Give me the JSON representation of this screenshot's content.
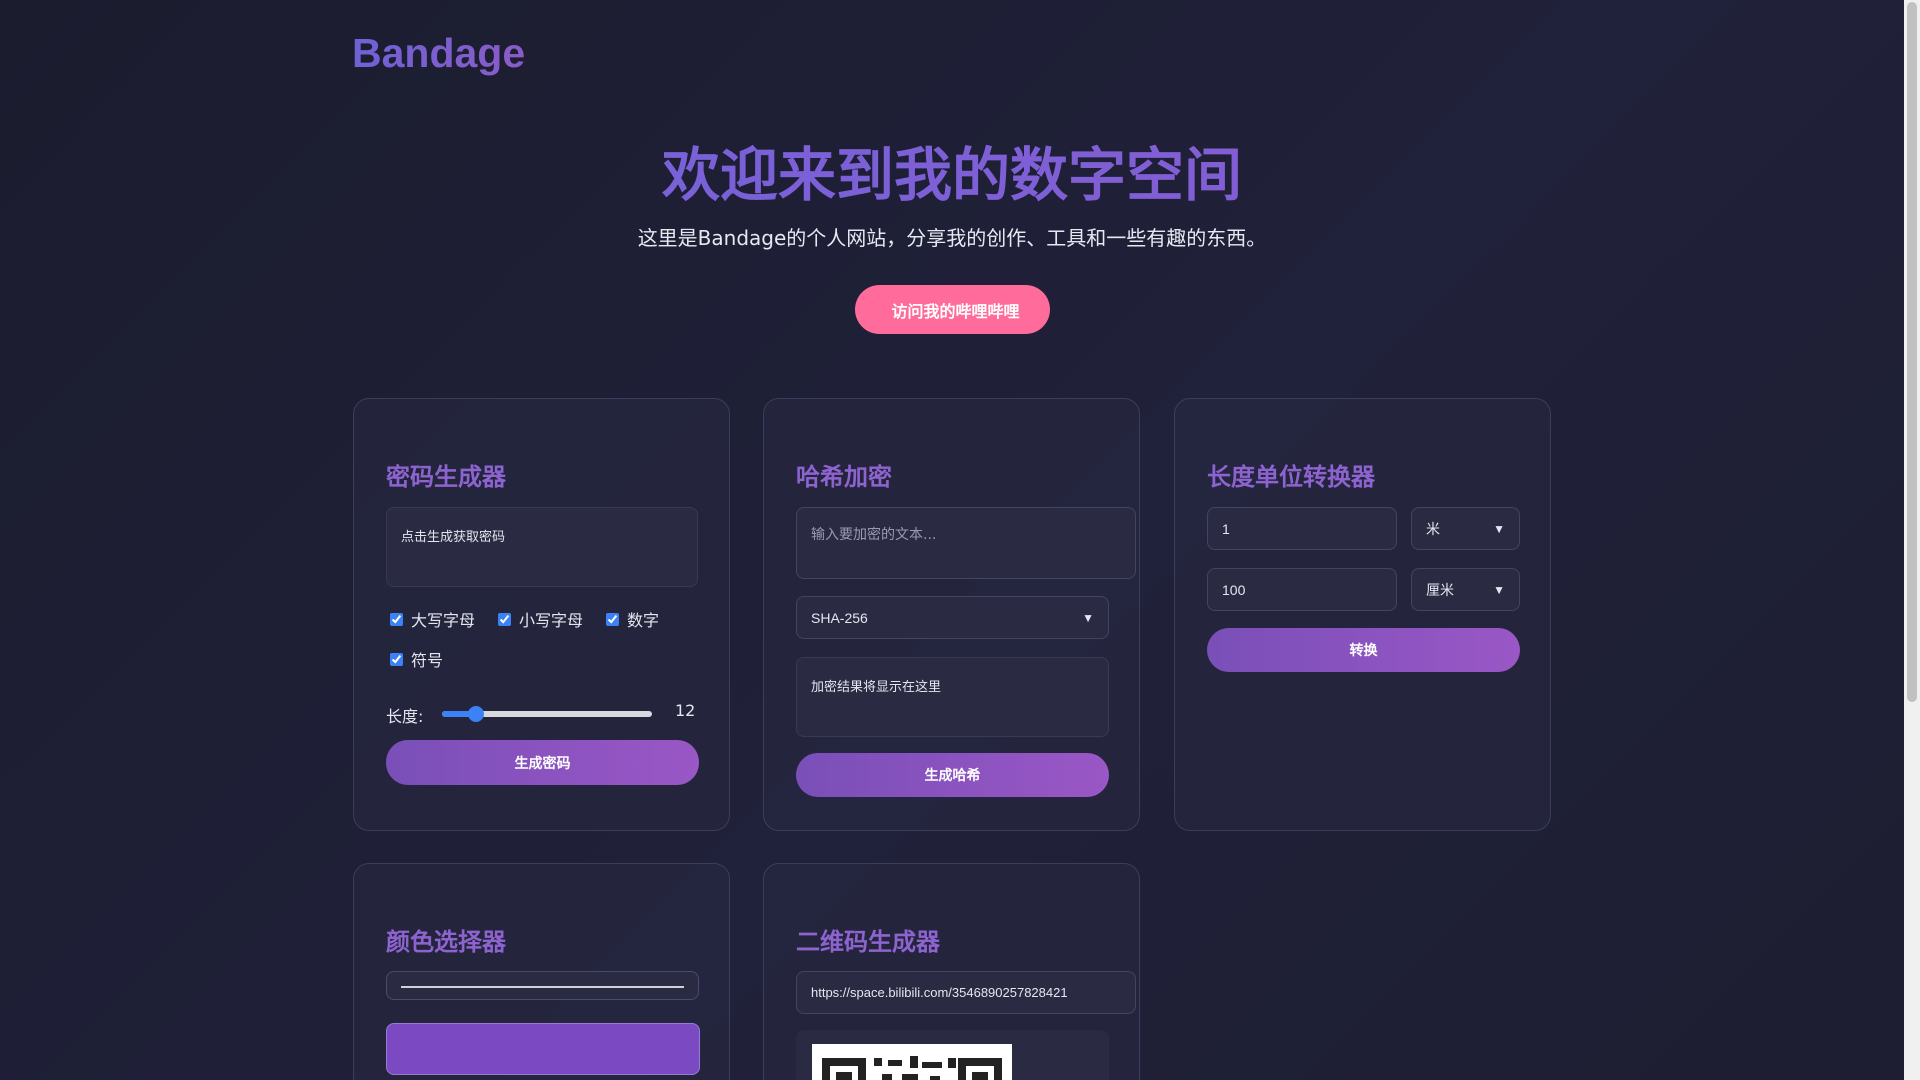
{
  "header": {
    "logo": "Bandage"
  },
  "hero": {
    "title": "欢迎来到我的数字空间",
    "subtitle": "这里是Bandage的个人网站，分享我的创作、工具和一些有趣的东西。",
    "button_icon": "",
    "button_label": "访问我的哔哩哔哩"
  },
  "password_card": {
    "title": "密码生成器",
    "output_text": "点击生成获取密码",
    "copy_icon": "",
    "options": [
      {
        "label": "大写字母",
        "checked": true
      },
      {
        "label": "小写字母",
        "checked": true
      },
      {
        "label": "数字",
        "checked": true
      },
      {
        "label": "符号",
        "checked": true
      }
    ],
    "length_label": "长度:",
    "length_value": "12",
    "length_fraction": 0.16,
    "button": "生成密码"
  },
  "hash_card": {
    "title": "哈希加密",
    "input_placeholder": "输入要加密的文本...",
    "algorithm": "SHA-256",
    "result_text": "加密结果将显示在这里",
    "copy_icon": "",
    "button": "生成哈希"
  },
  "length_card": {
    "title": "长度单位转换器",
    "from_value": "1",
    "from_unit": "米",
    "to_value": "100",
    "to_unit": "厘米",
    "button": "转换"
  },
  "color_card": {
    "title": "颜色选择器",
    "selected_color": "#7b49c2"
  },
  "qr_card": {
    "title": "二维码生成器",
    "url_value": "https://space.bilibili.com/3546890257828421"
  },
  "colors": {
    "accent_pink": "#ff6b9a",
    "accent_purple": "#8d63d0",
    "checkbox_blue": "#3b82f6"
  }
}
